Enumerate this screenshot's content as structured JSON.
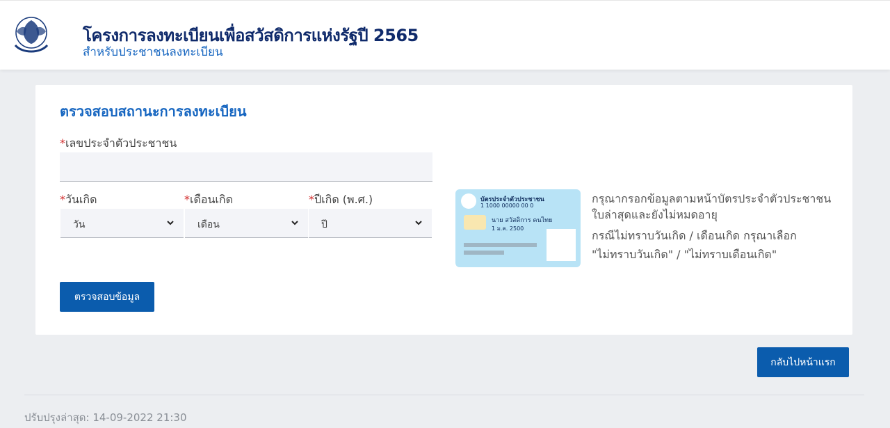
{
  "header": {
    "title": "โครงการลงทะเบียนเพื่อสวัสดิการแห่งรัฐปี 2565",
    "subtitle": "สำหรับประชาชนลงทะเบียน"
  },
  "form": {
    "title": "ตรวจสอบสถานะการลงทะเบียน",
    "required_mark": "*",
    "id_label": "เลขประจำตัวประชาชน",
    "id_value": "",
    "day_label": "วันเกิด",
    "day_value": "วัน",
    "month_label": "เดือนเกิด",
    "month_value": "เดือน",
    "year_label": "ปีเกิด (พ.ศ.)",
    "year_value": "ปี",
    "submit_label": "ตรวจสอบข้อมูล"
  },
  "id_card": {
    "heading": "บัตรประจำตัวประชาชน",
    "number": "1 1000 00000 00 0",
    "name": "นาย สวัสดิการ คนไทย",
    "dob": "1 ม.ค. 2500"
  },
  "instructions": {
    "line1": "กรุณากรอกข้อมูลตามหน้าบัตรประจำตัวประชาชน",
    "line2": "ใบล่าสุดและยังไม่หมดอายุ",
    "line3": "กรณีไม่ทราบวันเกิด / เดือนเกิด กรุณาเลือก",
    "line4": "\"ไม่ทราบวันเกิด\" / \"ไม่ทราบเดือนเกิด\""
  },
  "nav": {
    "home_label": "กลับไปหน้าแรก"
  },
  "footer": {
    "updated": "ปรับปรุงล่าสุด: 14-09-2022 21:30"
  },
  "colors": {
    "primary": "#0b5cad",
    "title": "#0f2a6b",
    "accent": "#1565c0",
    "required": "#d32f2f"
  },
  "icons": {
    "logo": "garuda-emblem-icon",
    "select_arrow": "chevron-down-icon"
  }
}
